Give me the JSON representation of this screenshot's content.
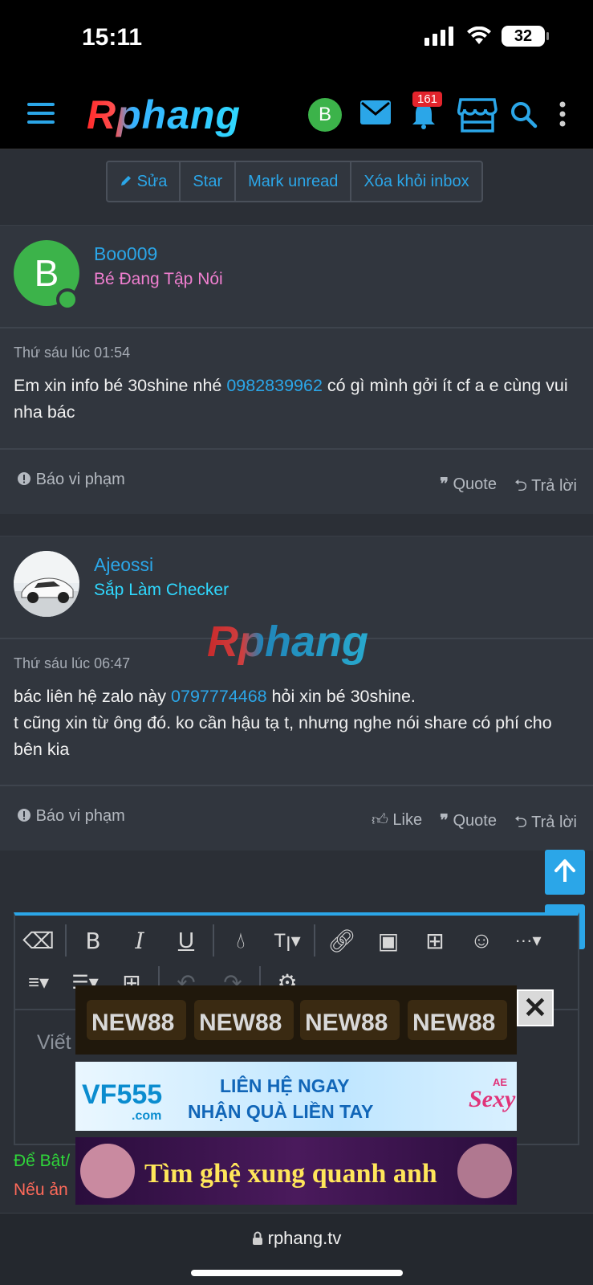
{
  "status": {
    "time": "15:11",
    "battery": "32",
    "battery_level": 0.32
  },
  "header": {
    "logo": "Rphang",
    "avatar_letter": "B",
    "notif_count": "161"
  },
  "actions": [
    "Sửa",
    "Star",
    "Mark unread",
    "Xóa khỏi inbox"
  ],
  "messages": [
    {
      "avatar_letter": "B",
      "username": "Boo009",
      "usertitle": "Bé Đang Tập Nói",
      "date": "Thứ sáu lúc 01:54",
      "text_before": "Em xin info bé 30shine nhé ",
      "phone": "0982839962",
      "text_after": " có gì mình gởi ít cf a e cùng vui nha bác",
      "report": "Báo vi phạm",
      "quote": "Quote",
      "reply": "Trả lời"
    },
    {
      "username": "Ajeossi",
      "usertitle": "Sắp Làm Checker",
      "date": "Thứ sáu lúc 06:47",
      "text_before": "bác liên hệ zalo này ",
      "phone": "0797774468",
      "text_after": " hỏi xin bé 30shine.",
      "text_line2": "t cũng xin từ ông đó. ko cần hậu tạ t, nhưng nghe nói share có phí cho bên kia",
      "report": "Báo vi phạm",
      "like": "Like",
      "quote": "Quote",
      "reply": "Trả lời"
    }
  ],
  "watermark": "Rphang",
  "editor": {
    "placeholder": "Viết"
  },
  "hints": {
    "green": "Để Bật/",
    "red": "Nếu ản"
  },
  "ads": {
    "new88": [
      "NEW88",
      "NEW88",
      "NEW88",
      "NEW88"
    ],
    "vf555_brand": "VF555",
    "vf555_domain": ".com",
    "vf555_line1": "LIÊN HỆ NGAY",
    "vf555_line2": "NHẬN QUÀ LIỀN TAY",
    "sexy_brand": "Sexy",
    "sexy_prefix": "AE",
    "date_banner": "Tìm ghệ xung quanh anh"
  },
  "browser": {
    "url": "rphang.tv"
  },
  "colors": {
    "accent": "#2ba6e8",
    "green": "#3cb34a",
    "pink": "#f07fd0",
    "cyan": "#2fd9ff",
    "badge": "#e2242c"
  }
}
